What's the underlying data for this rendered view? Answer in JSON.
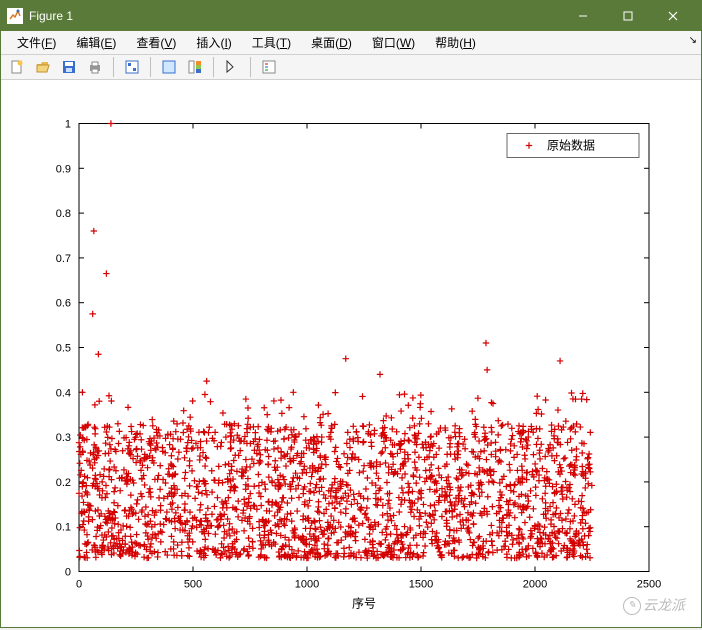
{
  "window": {
    "title": "Figure 1"
  },
  "menu": {
    "file": {
      "label": "文件",
      "key": "F"
    },
    "edit": {
      "label": "编辑",
      "key": "E"
    },
    "view": {
      "label": "查看",
      "key": "V"
    },
    "insert": {
      "label": "插入",
      "key": "I"
    },
    "tools": {
      "label": "工具",
      "key": "T"
    },
    "desktop": {
      "label": "桌面",
      "key": "D"
    },
    "window_": {
      "label": "窗口",
      "key": "W"
    },
    "help": {
      "label": "帮助",
      "key": "H"
    }
  },
  "toolbar_icons": {
    "new": "new-figure-icon",
    "open": "open-icon",
    "save": "save-icon",
    "print": "print-icon",
    "link": "link-data-icon",
    "datacursor": "data-cursor-icon",
    "colorbar": "colorbar-icon",
    "arrow": "edit-plot-icon",
    "legend": "insert-legend-icon"
  },
  "legend": {
    "label": "原始数据"
  },
  "watermark": {
    "text": "云龙派"
  },
  "chart_data": {
    "type": "scatter",
    "marker": "+",
    "color": "#d40000",
    "title": "",
    "xlabel": "序号",
    "ylabel": "",
    "xlim": [
      0,
      2500
    ],
    "ylim": [
      0,
      1
    ],
    "xticks": [
      0,
      500,
      1000,
      1500,
      2000,
      2500
    ],
    "yticks": [
      0,
      0.1,
      0.2,
      0.3,
      0.4,
      0.5,
      0.6,
      0.7,
      0.8,
      0.9,
      1
    ],
    "n_points": 2250,
    "series": [
      {
        "name": "原始数据",
        "distribution": "dense between x=0..2250, y mostly 0.02..0.35",
        "outliers": [
          {
            "x": 140,
            "y": 1.0
          },
          {
            "x": 65,
            "y": 0.76
          },
          {
            "x": 120,
            "y": 0.665
          },
          {
            "x": 60,
            "y": 0.575
          },
          {
            "x": 1785,
            "y": 0.51
          },
          {
            "x": 85,
            "y": 0.485
          },
          {
            "x": 2110,
            "y": 0.47
          },
          {
            "x": 1170,
            "y": 0.475
          },
          {
            "x": 1320,
            "y": 0.44
          },
          {
            "x": 1790,
            "y": 0.45
          },
          {
            "x": 560,
            "y": 0.425
          },
          {
            "x": 940,
            "y": 0.4
          },
          {
            "x": 15,
            "y": 0.4
          }
        ]
      }
    ]
  }
}
